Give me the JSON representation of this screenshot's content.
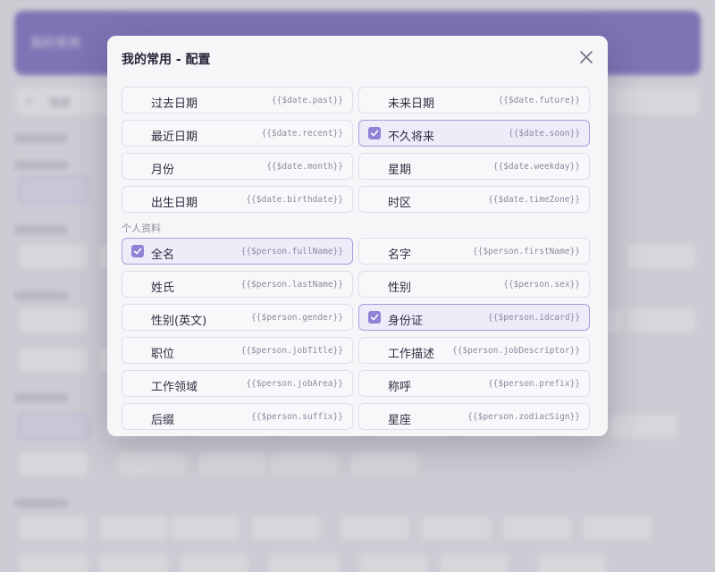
{
  "modal": {
    "title": "我的常用 - 配置"
  },
  "background": {
    "header_title": "我的常用",
    "search_placeholder": "搜索",
    "sections": [
      {
        "label": "",
        "count": ""
      }
    ]
  },
  "date_items": [
    {
      "label": "过去日期",
      "code": "{{$date.past}}",
      "checked": false
    },
    {
      "label": "未来日期",
      "code": "{{$date.future}}",
      "checked": false
    },
    {
      "label": "最近日期",
      "code": "{{$date.recent}}",
      "checked": false
    },
    {
      "label": "不久将来",
      "code": "{{$date.soon}}",
      "checked": true
    },
    {
      "label": "月份",
      "code": "{{$date.month}}",
      "checked": false
    },
    {
      "label": "星期",
      "code": "{{$date.weekday}}",
      "checked": false
    },
    {
      "label": "出生日期",
      "code": "{{$date.birthdate}}",
      "checked": false
    },
    {
      "label": "时区",
      "code": "{{$date.timeZone}}",
      "checked": false
    }
  ],
  "person_section": {
    "label": "个人资料"
  },
  "person_items": [
    {
      "label": "全名",
      "code": "{{$person.fullName}}",
      "checked": true
    },
    {
      "label": "名字",
      "code": "{{$person.firstName}}",
      "checked": false
    },
    {
      "label": "姓氏",
      "code": "{{$person.lastName}}",
      "checked": false
    },
    {
      "label": "性别",
      "code": "{{$person.sex}}",
      "checked": false
    },
    {
      "label": "性别(英文)",
      "code": "{{$person.gender}}",
      "checked": false
    },
    {
      "label": "身份证",
      "code": "{{$person.idcard}}",
      "checked": true
    },
    {
      "label": "职位",
      "code": "{{$person.jobTitle}}",
      "checked": false
    },
    {
      "label": "工作描述",
      "code": "{{$person.jobDescriptor}}",
      "checked": false
    },
    {
      "label": "工作领域",
      "code": "{{$person.jobArea}}",
      "checked": false
    },
    {
      "label": "称呼",
      "code": "{{$person.prefix}}",
      "checked": false
    },
    {
      "label": "后缀",
      "code": "{{$person.suffix}}",
      "checked": false
    },
    {
      "label": "星座",
      "code": "{{$person.zodiacSign}}",
      "checked": false
    }
  ],
  "colors": {
    "accent": "#8e82d6",
    "checked_bg": "#eeecf9",
    "checked_border": "#a69ce0",
    "header_bg": "#8f82cf"
  },
  "icons": {
    "close": "close-icon",
    "check": "check-icon",
    "search": "search-icon"
  }
}
